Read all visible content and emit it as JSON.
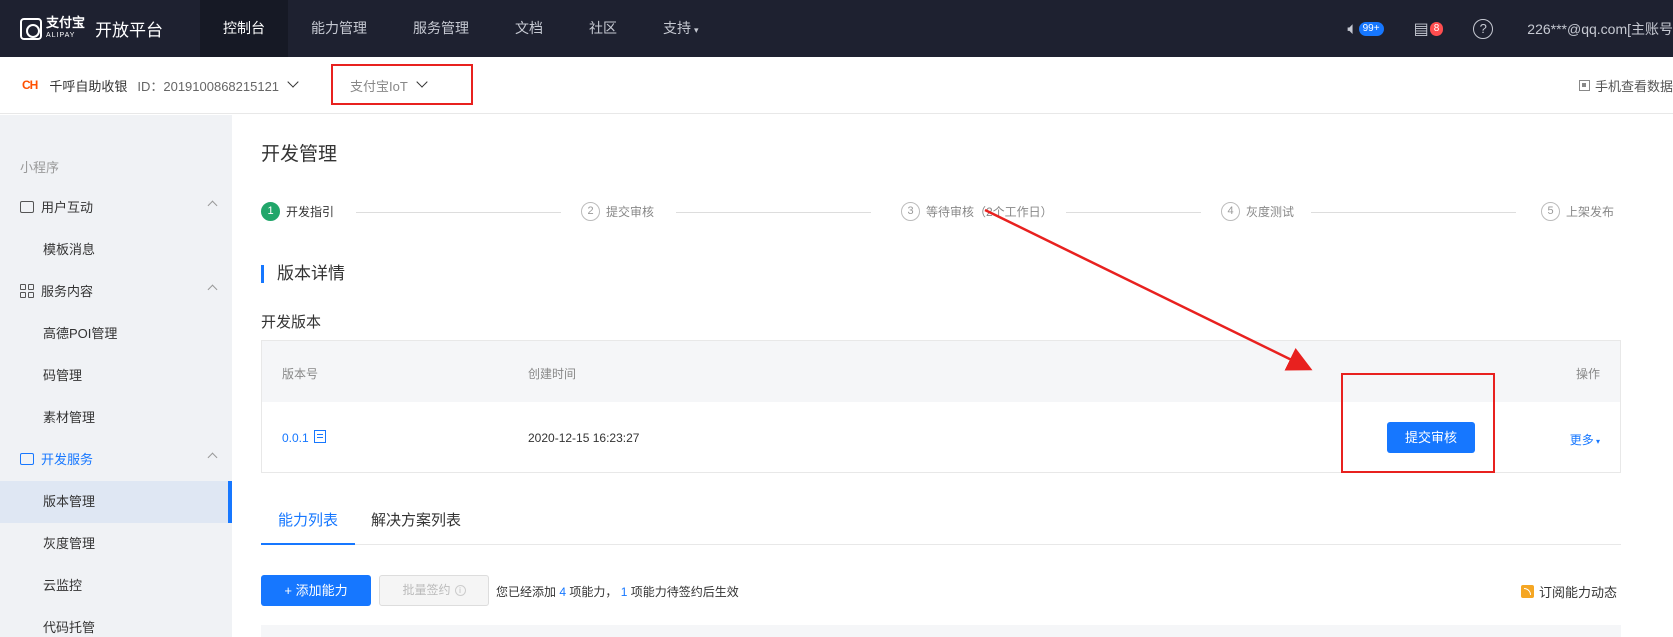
{
  "topnav": {
    "brand_name": "支付宝",
    "brand_sub": "ALIPAY",
    "platform_title": "开放平台",
    "items": [
      {
        "label": "控制台"
      },
      {
        "label": "能力管理"
      },
      {
        "label": "服务管理"
      },
      {
        "label": "文档"
      },
      {
        "label": "社区"
      },
      {
        "label": "支持"
      }
    ],
    "sound_badge": "99+",
    "notice_badge": "8",
    "help_symbol": "?",
    "user": "226***@qq.com[主账号"
  },
  "subheader": {
    "app_logo": "CH",
    "app_name": "千呼自助收银",
    "app_id": "ID：2019100868215121",
    "platform_select": "支付宝IoT",
    "mobile_view": "手机查看数据"
  },
  "sidebar": {
    "group_title": "小程序",
    "sections": [
      {
        "label": "用户互动",
        "icon": "message-icon"
      },
      {
        "label": "服务内容",
        "icon": "grid-icon"
      },
      {
        "label": "开发服务",
        "icon": "code-icon"
      }
    ],
    "items": [
      {
        "label": "模板消息"
      },
      {
        "label": "高德POI管理"
      },
      {
        "label": "码管理"
      },
      {
        "label": "素材管理"
      },
      {
        "label": "版本管理"
      },
      {
        "label": "灰度管理"
      },
      {
        "label": "云监控"
      },
      {
        "label": "代码托管"
      }
    ]
  },
  "main": {
    "page_title": "开发管理",
    "steps": [
      {
        "num": "1",
        "label": "开发指引"
      },
      {
        "num": "2",
        "label": "提交审核"
      },
      {
        "num": "3",
        "label": "等待审核（2个工作日）"
      },
      {
        "num": "4",
        "label": "灰度测试"
      },
      {
        "num": "5",
        "label": "上架发布"
      }
    ],
    "section_title": "版本详情",
    "sub_title": "开发版本",
    "table": {
      "col_version": "版本号",
      "col_created": "创建时间",
      "col_action": "操作",
      "row_version": "0.0.1",
      "row_created": "2020-12-15 16:23:27",
      "submit_label": "提交审核",
      "more_label": "更多"
    },
    "tabs": [
      {
        "label": "能力列表"
      },
      {
        "label": "解决方案列表"
      }
    ],
    "add_button": "+  添加能力",
    "batch_button": "批量签约",
    "notice_prefix": "您已经添加",
    "notice_count1": "4",
    "notice_mid": "项能力，",
    "notice_count2": "1",
    "notice_suffix": "项能力待签约后生效",
    "subscribe": "订阅能力动态"
  },
  "colors": {
    "nav_bg": "#1e2130",
    "accent": "#1677ff",
    "success": "#21a66a",
    "annotation_red": "#e8211f"
  }
}
